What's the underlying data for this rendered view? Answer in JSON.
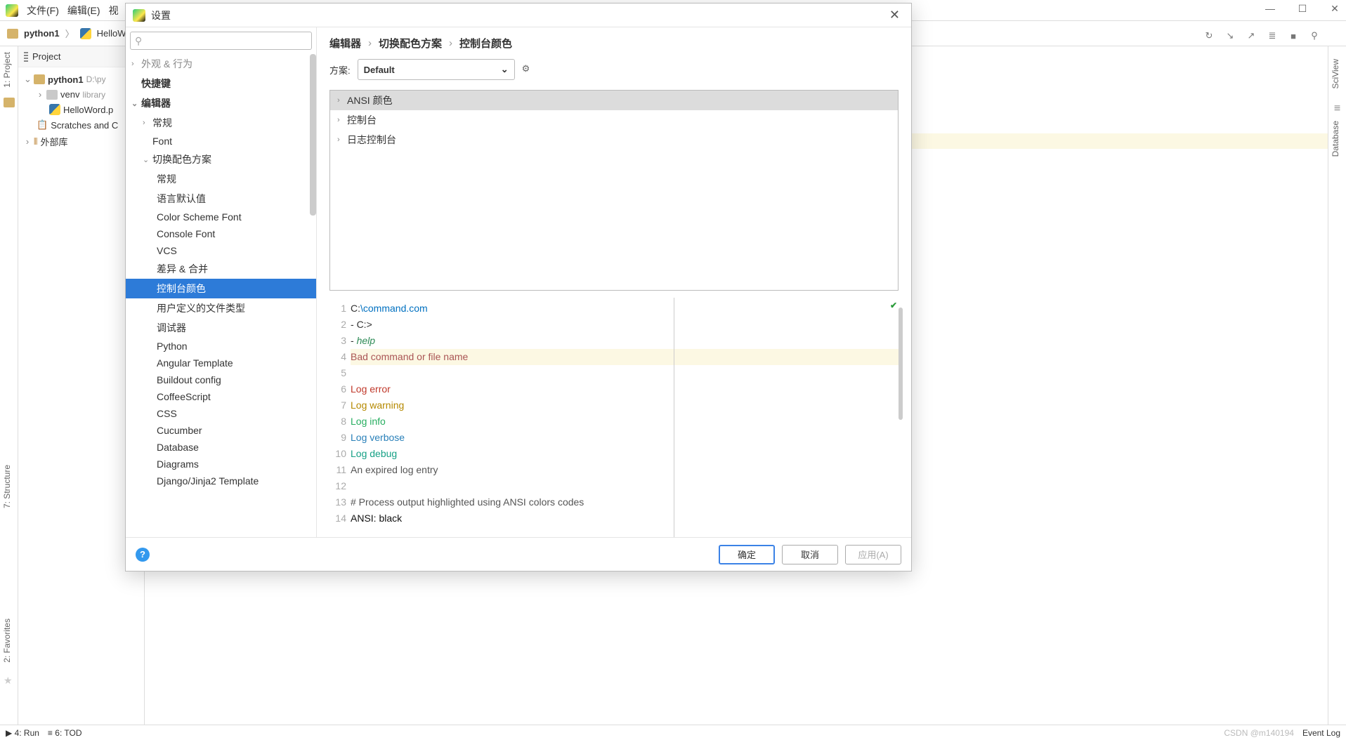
{
  "menubar": {
    "items": [
      "文件(F)",
      "编辑(E)",
      "视"
    ]
  },
  "win": {
    "min": "—",
    "max": "☐",
    "close": "✕"
  },
  "ide_crumbs": {
    "root": "python1",
    "file": "HelloW"
  },
  "toolbar_icons": [
    "↻",
    "↘",
    "↗",
    "≣",
    "■",
    "⚲"
  ],
  "gutter_left": {
    "project": "1: Project",
    "structure": "7: Structure",
    "fav": "2: Favorites"
  },
  "gutter_right": {
    "sciview": "SciView",
    "database": "Database"
  },
  "project": {
    "header": "Project",
    "root": "python1",
    "root_path": "D:\\py",
    "venv": "venv",
    "venv_note": "library",
    "hello": "HelloWord.p",
    "scratches": "Scratches and C",
    "ext": "外部库"
  },
  "dialog": {
    "title": "设置",
    "search_placeholder": "",
    "close": "✕",
    "tree_top": "外观 & 行为",
    "tree": {
      "shortcuts": "快捷键",
      "editor": "编辑器",
      "general": "常规",
      "font": "Font",
      "scheme_switch": "切换配色方案",
      "scheme_general": "常规",
      "lang_defaults": "语言默认值",
      "csfont": "Color Scheme Font",
      "console_font": "Console Font",
      "vcs": "VCS",
      "diff": "差异 & 合并",
      "console_colors": "控制台颜色",
      "user_types": "用户定义的文件类型",
      "debug": "调试器",
      "python": "Python",
      "angular": "Angular Template",
      "buildout": "Buildout config",
      "coffee": "CoffeeScript",
      "css": "CSS",
      "cucumber": "Cucumber",
      "database": "Database",
      "diagrams": "Diagrams",
      "django": "Django/Jinja2 Template"
    },
    "crumbs": {
      "a": "编辑器",
      "b": "切换配色方案",
      "c": "控制台颜色"
    },
    "scheme_label": "方案:",
    "scheme_value": "Default",
    "group": {
      "ansi": "ANSI 颜色",
      "console": "控制台",
      "logconsole": "日志控制台"
    },
    "preview_lines": [
      "C:\\command.com",
      "- C:>",
      "- help",
      "Bad command or file name",
      "",
      "Log error",
      "Log warning",
      "Log info",
      "Log verbose",
      "Log debug",
      "An expired log entry",
      "",
      "# Process output highlighted using ANSI colors codes",
      "ANSI: black"
    ],
    "footer": {
      "ok": "确定",
      "cancel": "取消",
      "apply": "应用(A)"
    }
  },
  "status": {
    "run": "4: Run",
    "todo": "6: TOD",
    "eventlog": "Event Log",
    "watermark": "CSDN @m140194"
  }
}
